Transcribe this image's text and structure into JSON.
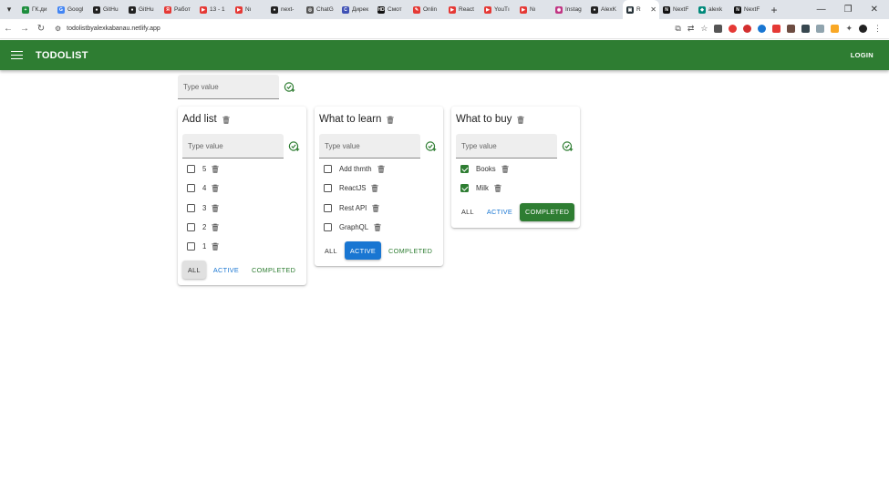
{
  "browser": {
    "tabs": [
      {
        "title": "ГК.ди",
        "color": "#1e8e3e",
        "glyph": "+"
      },
      {
        "title": "Googl",
        "color": "#4285f4",
        "glyph": "G"
      },
      {
        "title": "GitHu",
        "color": "#222222",
        "glyph": "●"
      },
      {
        "title": "GitHu",
        "color": "#222222",
        "glyph": "●"
      },
      {
        "title": "Работ",
        "color": "#e53935",
        "glyph": "Я"
      },
      {
        "title": "13 - 1",
        "color": "#e53935",
        "glyph": "▶"
      },
      {
        "title": "Nı",
        "color": "#e53935",
        "glyph": "▶"
      },
      {
        "title": "next-",
        "color": "#222222",
        "glyph": "●"
      },
      {
        "title": "ChatG",
        "color": "#555555",
        "glyph": "◎"
      },
      {
        "title": "Дирек",
        "color": "#3f51b5",
        "glyph": "C"
      },
      {
        "title": "Смот",
        "color": "#111111",
        "glyph": "HD"
      },
      {
        "title": "Onlin",
        "color": "#e53935",
        "glyph": "✎"
      },
      {
        "title": "React",
        "color": "#e53935",
        "glyph": "▶"
      },
      {
        "title": "YouTı",
        "color": "#e53935",
        "glyph": "▶"
      },
      {
        "title": "Nı",
        "color": "#e53935",
        "glyph": "▶"
      },
      {
        "title": "Instag",
        "color": "#c13584",
        "glyph": "◉"
      },
      {
        "title": "AlexK",
        "color": "#222222",
        "glyph": "●"
      },
      {
        "title": "R",
        "color": "#263238",
        "glyph": "▣",
        "active": true
      },
      {
        "title": "NextF",
        "color": "#111111",
        "glyph": "N"
      },
      {
        "title": "alexk",
        "color": "#00897b",
        "glyph": "◆"
      },
      {
        "title": "NextF",
        "color": "#111111",
        "glyph": "N"
      }
    ],
    "tab_close": "✕",
    "new_tab": "+",
    "window_controls": {
      "minimize": "—",
      "restore": "❐",
      "close": "✕"
    },
    "url": "todolistbyalexkabanau.netlify.app",
    "nav": {
      "back": "←",
      "forward": "→",
      "reload": "↻"
    }
  },
  "appbar": {
    "title": "TODOLIST",
    "login": "LOGIN"
  },
  "add_list": {
    "placeholder": "Type value"
  },
  "todolists": [
    {
      "title": "Add list",
      "placeholder": "Type value",
      "tasks": [
        {
          "label": "5",
          "done": false
        },
        {
          "label": "4",
          "done": false
        },
        {
          "label": "3",
          "done": false
        },
        {
          "label": "2",
          "done": false
        },
        {
          "label": "1",
          "done": false
        }
      ],
      "filters": {
        "all": "ALL",
        "active": "ACTIVE",
        "completed": "COMPLETED"
      },
      "selected_filter": "all"
    },
    {
      "title": "What to learn",
      "placeholder": "Type value",
      "tasks": [
        {
          "label": "Add thmth",
          "done": false
        },
        {
          "label": "ReactJS",
          "done": false
        },
        {
          "label": "Rest API",
          "done": false
        },
        {
          "label": "GraphQL",
          "done": false
        }
      ],
      "filters": {
        "all": "ALL",
        "active": "ACTIVE",
        "completed": "COMPLETED"
      },
      "selected_filter": "active"
    },
    {
      "title": "What to buy",
      "placeholder": "Type value",
      "tasks": [
        {
          "label": "Books",
          "done": true
        },
        {
          "label": "Milk",
          "done": true
        }
      ],
      "filters": {
        "all": "ALL",
        "active": "ACTIVE",
        "completed": "COMPLETED"
      },
      "selected_filter": "completed"
    }
  ],
  "colors": {
    "primary": "#2e7d32",
    "secondary": "#1976d2"
  }
}
